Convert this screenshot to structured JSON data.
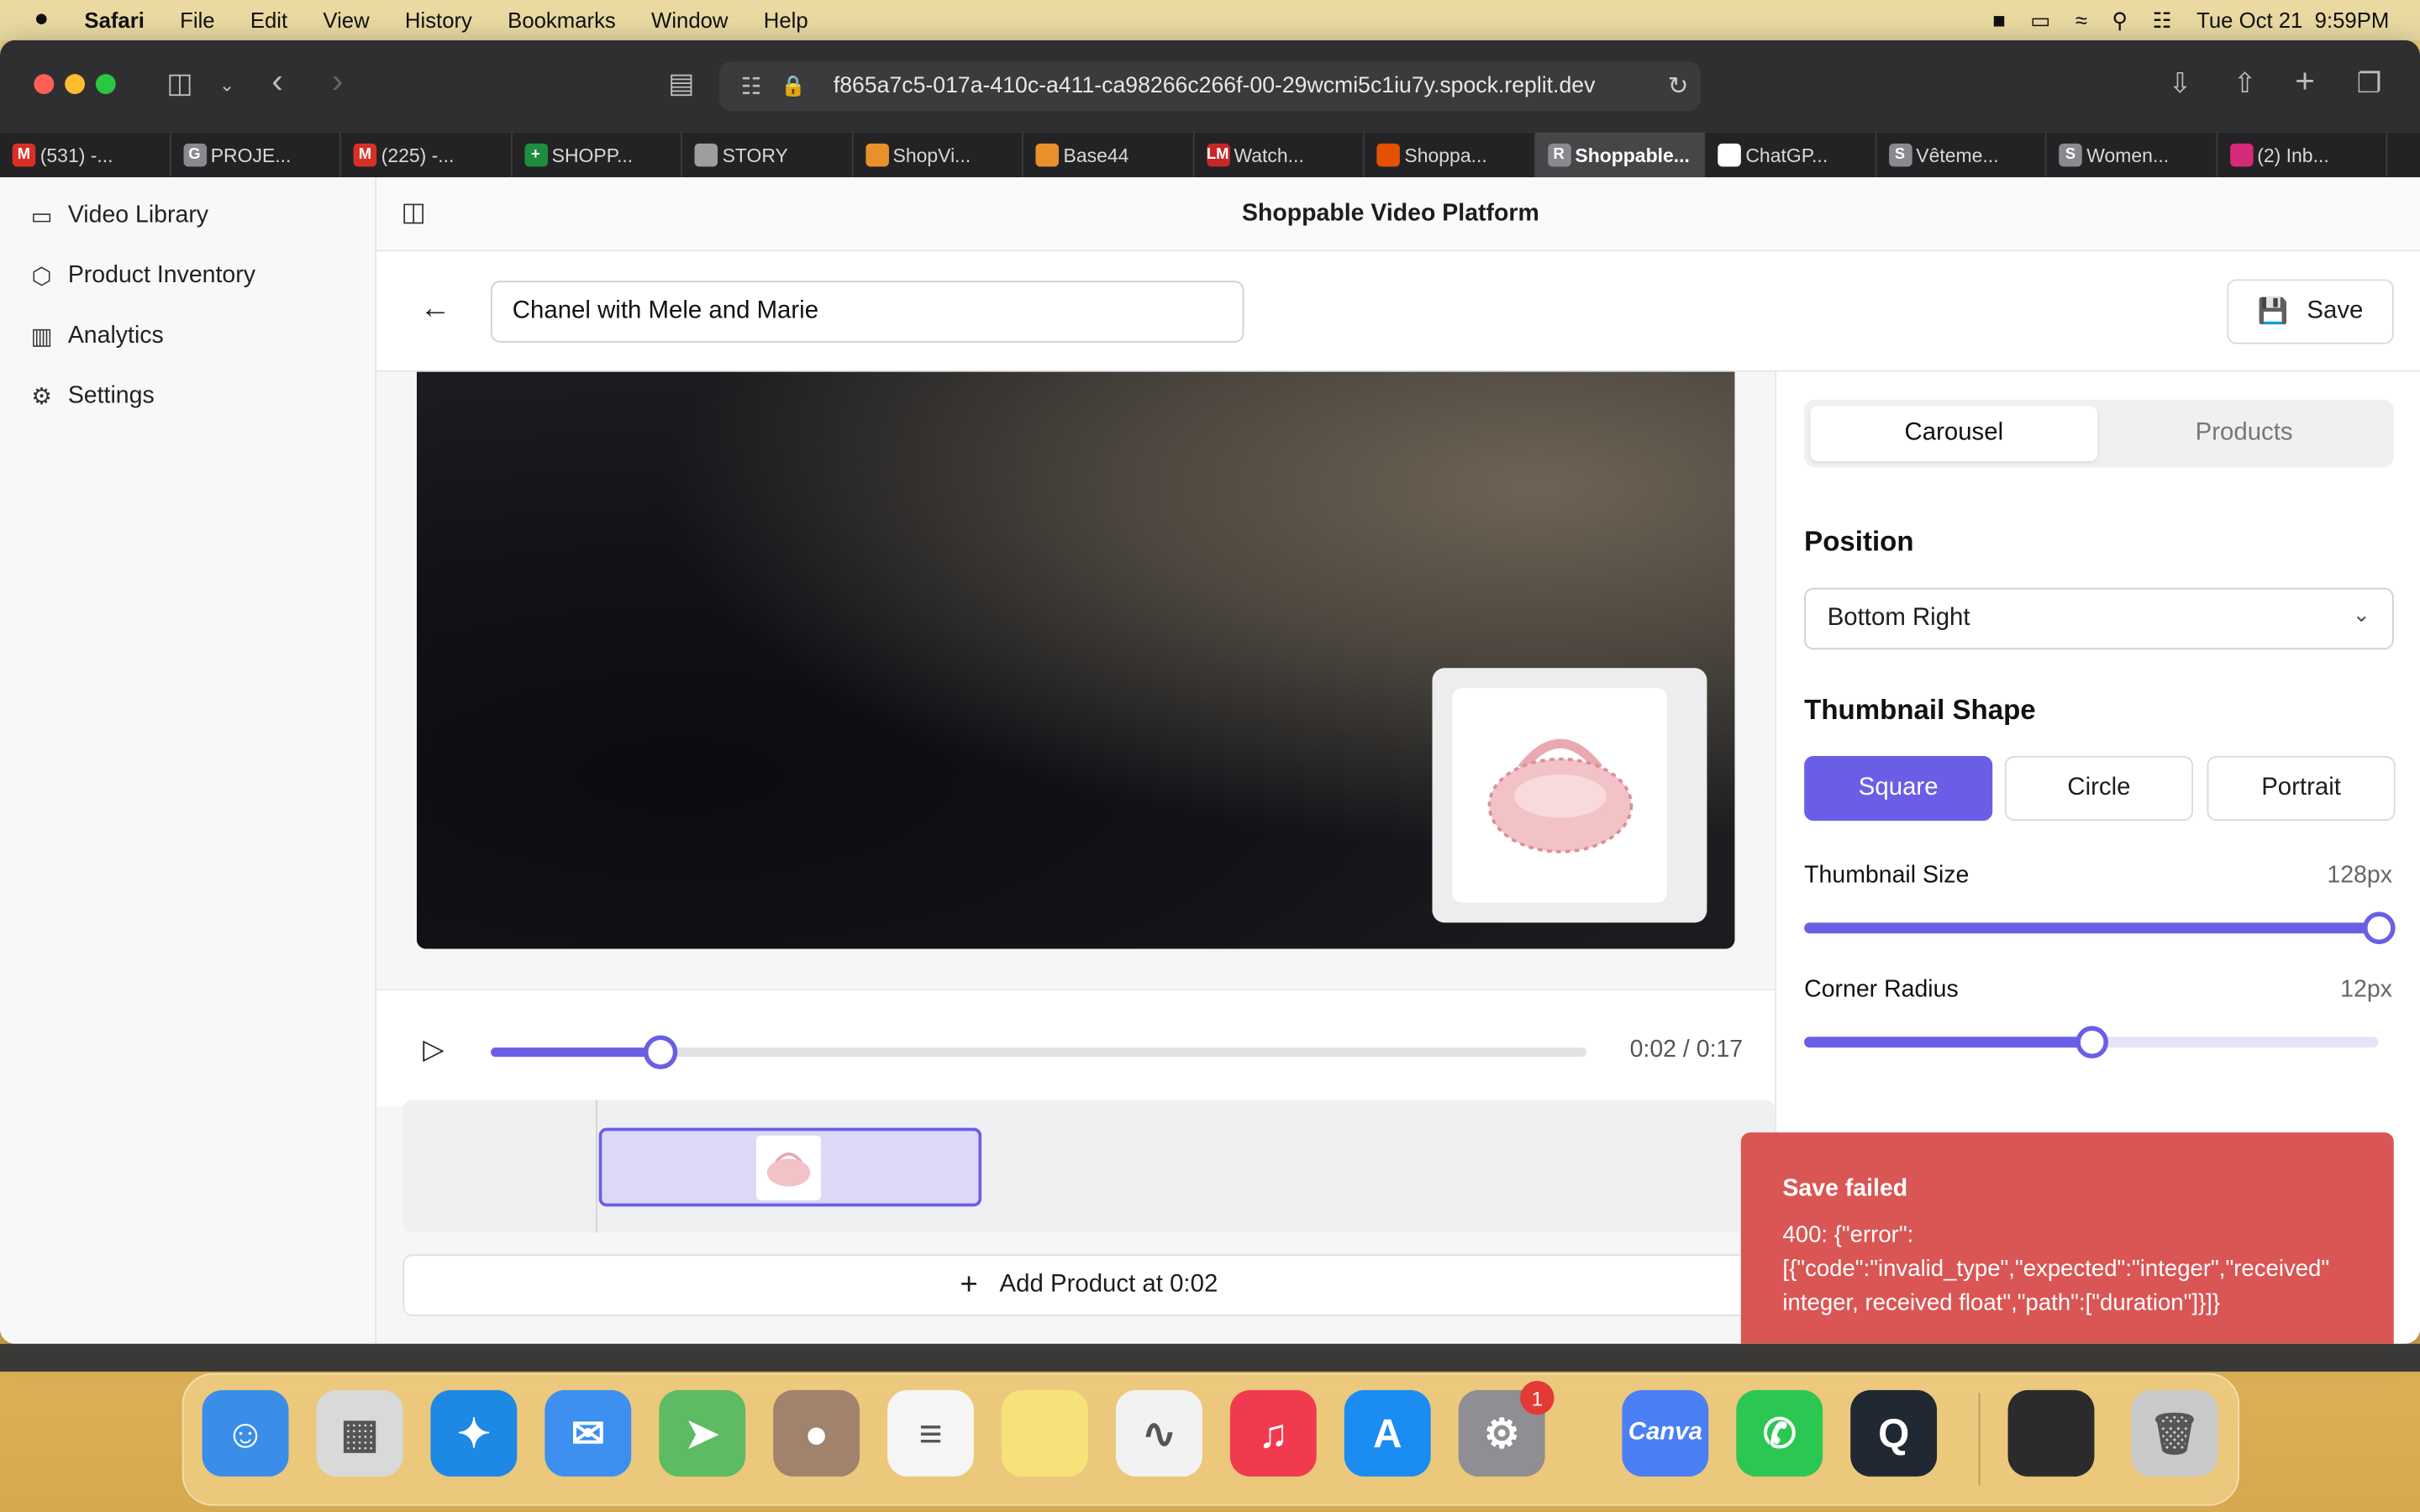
{
  "menubar": {
    "apple": "",
    "app": "Safari",
    "items": [
      "File",
      "Edit",
      "View",
      "History",
      "Bookmarks",
      "Window",
      "Help"
    ],
    "datetime": "Tue Oct 21  9:59PM"
  },
  "browser": {
    "url": "f865a7c5-017a-410c-a411-ca98266c266f-00-29wcmi5c1iu7y.spock.replit.dev",
    "tabs": [
      {
        "label": "(531) -...",
        "icon": "gmail-icon",
        "color": "#d93025",
        "glyph": "M"
      },
      {
        "label": "PROJE...",
        "icon": "g-icon",
        "color": "#8a8a8e",
        "glyph": "G"
      },
      {
        "label": "(225) -...",
        "icon": "gmail-icon",
        "color": "#d93025",
        "glyph": "M"
      },
      {
        "label": "SHOPP...",
        "icon": "sheets-icon",
        "color": "#1e8e3e",
        "glyph": "+"
      },
      {
        "label": "STORY",
        "icon": "page-icon",
        "color": "#9e9e9e",
        "glyph": ""
      },
      {
        "label": "ShopVi...",
        "icon": "sunset-icon",
        "color": "#e8902b",
        "glyph": ""
      },
      {
        "label": "Base44",
        "icon": "sunset-icon",
        "color": "#e8902b",
        "glyph": ""
      },
      {
        "label": "Watch...",
        "icon": "lm-icon",
        "color": "#c62828",
        "glyph": "LM"
      },
      {
        "label": "Shoppa...",
        "icon": "shopify-flow-icon",
        "color": "#e65100",
        "glyph": ""
      },
      {
        "label": "Shoppable...",
        "icon": "replit-icon",
        "color": "#8a8a8e",
        "glyph": "R",
        "active": true
      },
      {
        "label": "ChatGP...",
        "icon": "chatgpt-icon",
        "color": "#ffffff",
        "glyph": ""
      },
      {
        "label": "Vêteme...",
        "icon": "s-icon",
        "color": "#8a8a8e",
        "glyph": "S"
      },
      {
        "label": "Women...",
        "icon": "s-icon",
        "color": "#8a8a8e",
        "glyph": "S"
      },
      {
        "label": "(2) Inb...",
        "icon": "instagram-icon",
        "color": "#d62976",
        "glyph": ""
      }
    ]
  },
  "sidebar": {
    "items": [
      {
        "label": "Video Library",
        "icon": "video-icon",
        "glyph": "▭"
      },
      {
        "label": "Product Inventory",
        "icon": "package-icon",
        "glyph": "⬡"
      },
      {
        "label": "Analytics",
        "icon": "bar-chart-icon",
        "glyph": "▥"
      },
      {
        "label": "Settings",
        "icon": "gear-icon",
        "glyph": "⚙"
      }
    ]
  },
  "header": {
    "title": "Shoppable Video Platform"
  },
  "editor": {
    "video_name": "Chanel with Mele and Marie",
    "save_label": "Save",
    "time": "0:02 / 0:17",
    "progress": 0.155,
    "add_product_label": "Add Product at 0:02"
  },
  "panel": {
    "tabs": [
      "Carousel",
      "Products"
    ],
    "active_tab": "Carousel",
    "position_label": "Position",
    "position_value": "Bottom Right",
    "shape_label": "Thumbnail Shape",
    "shapes": [
      "Square",
      "Circle",
      "Portrait"
    ],
    "selected_shape": "Square",
    "size_label": "Thumbnail Size",
    "size_value": "128px",
    "size_fraction": 1.0,
    "radius_label": "Corner Radius",
    "radius_value": "12px",
    "radius_fraction": 0.5
  },
  "toast": {
    "title": "Save failed",
    "message": "400: {\"error\":\n[{\"code\":\"invalid_type\",\"expected\":\"integer\",\"received\"\ninteger, received float\",\"path\":[\"duration\"]}]}"
  },
  "dock": {
    "apps": [
      {
        "name": "finder-icon",
        "color": "#3b8ee8",
        "glyph": "☺"
      },
      {
        "name": "launchpad-icon",
        "color": "#d9d9d9",
        "glyph": "▦"
      },
      {
        "name": "safari-icon",
        "color": "#1e88e5",
        "glyph": "✦"
      },
      {
        "name": "mail-icon",
        "color": "#3d8ff0",
        "glyph": "✉"
      },
      {
        "name": "maps-icon",
        "color": "#5dbb63",
        "glyph": "➤"
      },
      {
        "name": "contacts-icon",
        "color": "#a0826d",
        "glyph": "●"
      },
      {
        "name": "reminders-icon",
        "color": "#f5f5f5",
        "glyph": "≡"
      },
      {
        "name": "notes-icon",
        "color": "#f7e27a",
        "glyph": ""
      },
      {
        "name": "freeform-icon",
        "color": "#f2f2f2",
        "glyph": "∿"
      },
      {
        "name": "music-icon",
        "color": "#f23a4f",
        "glyph": "♫"
      },
      {
        "name": "app-store-icon",
        "color": "#1a8cf2",
        "glyph": "A"
      },
      {
        "name": "system-settings-icon",
        "color": "#8e8e93",
        "glyph": "⚙",
        "badge": "1"
      },
      {
        "name": "canva-icon",
        "color": "#4a7ff5",
        "glyph": "Canva"
      },
      {
        "name": "whatsapp-icon",
        "color": "#2cc653",
        "glyph": "✆"
      },
      {
        "name": "quicktime-icon",
        "color": "#1f2833",
        "glyph": "Q"
      },
      {
        "name": "screenshot-preview-icon",
        "color": "#2b2b2b",
        "glyph": ""
      },
      {
        "name": "trash-icon",
        "color": "#c9c9c9",
        "glyph": "🗑"
      }
    ]
  }
}
